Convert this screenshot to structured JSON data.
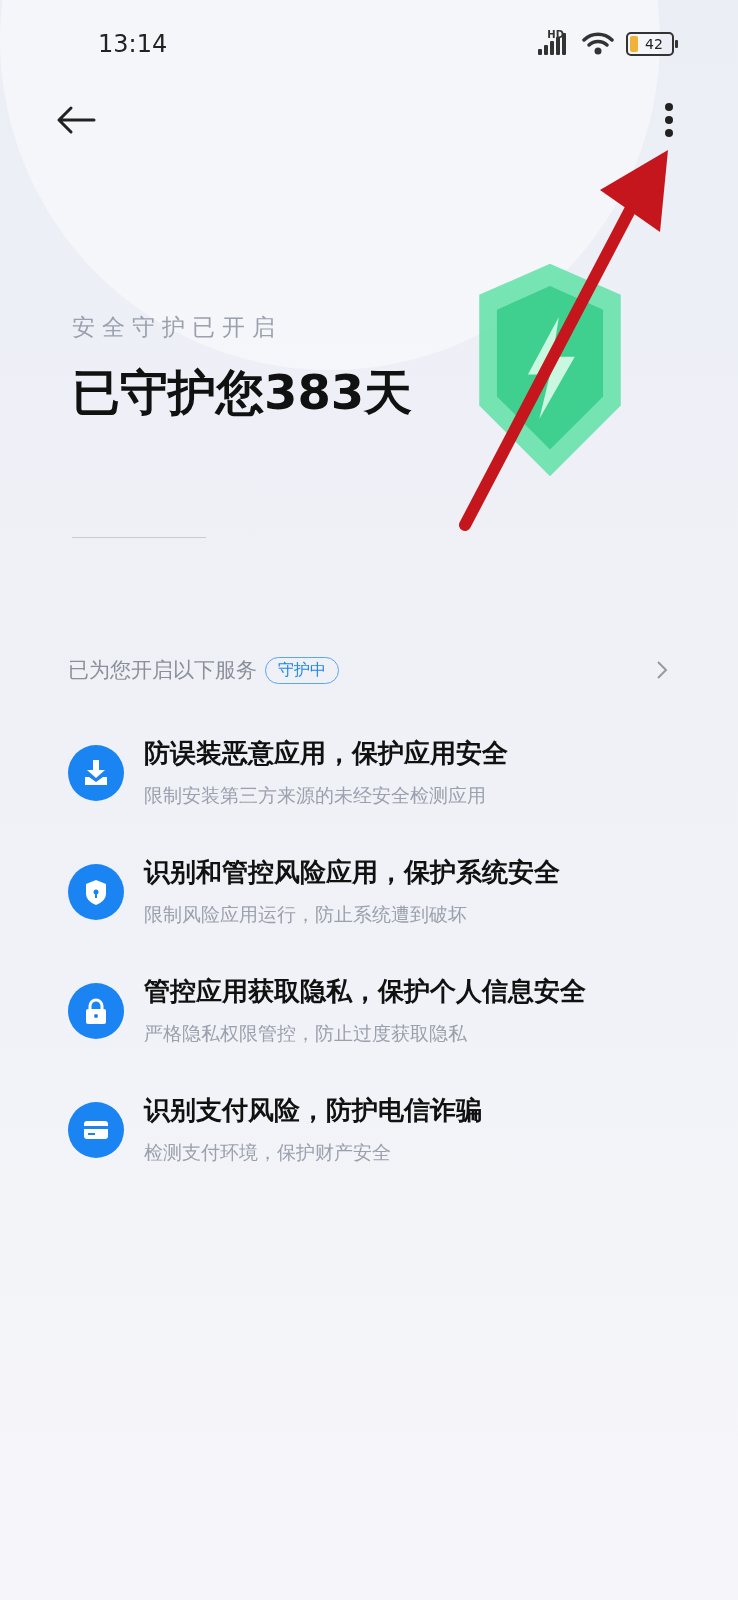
{
  "status_bar": {
    "time": "13:14",
    "network": "HD",
    "battery": "42"
  },
  "hero": {
    "subtitle": "安全守护已开启",
    "title": "已守护您383天"
  },
  "services": {
    "heading": "已为您开启以下服务",
    "badge": "守护中",
    "items": [
      {
        "kind": "download",
        "title": "防误装恶意应用，保护应用安全",
        "subtitle": "限制安装第三方来源的未经安全检测应用"
      },
      {
        "kind": "shield",
        "title": "识别和管控风险应用，保护系统安全",
        "subtitle": "限制风险应用运行，防止系统遭到破坏"
      },
      {
        "kind": "lock",
        "title": "管控应用获取隐私，保护个人信息安全",
        "subtitle": "严格隐私权限管控，防止过度获取隐私"
      },
      {
        "kind": "card",
        "title": "识别支付风险，防护电信诈骗",
        "subtitle": "检测支付环境，保护财产安全"
      }
    ]
  }
}
